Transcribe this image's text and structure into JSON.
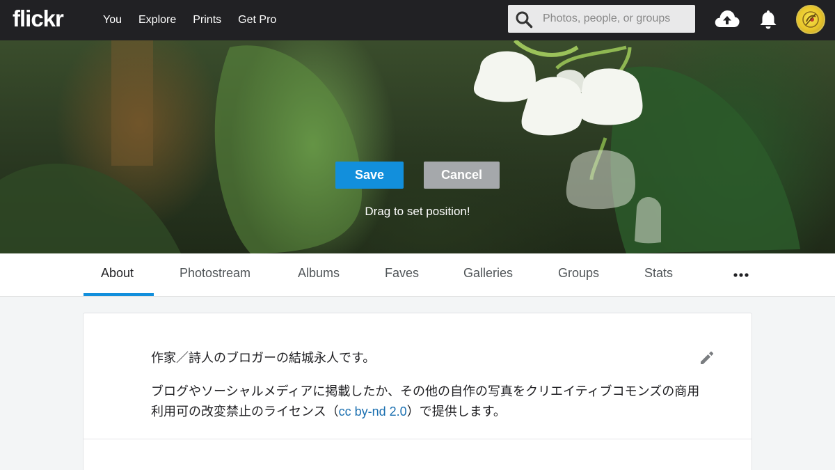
{
  "nav": {
    "logo": "flickr",
    "links": [
      "You",
      "Explore",
      "Prints",
      "Get Pro"
    ],
    "search_placeholder": "Photos, people, or groups",
    "icons": {
      "search": "search-icon",
      "upload": "cloud-upload-icon",
      "notifications": "bell-icon"
    }
  },
  "cover": {
    "save_label": "Save",
    "cancel_label": "Cancel",
    "drag_hint": "Drag to set position!"
  },
  "tabs": [
    {
      "label": "About",
      "active": true
    },
    {
      "label": "Photostream",
      "active": false
    },
    {
      "label": "Albums",
      "active": false
    },
    {
      "label": "Faves",
      "active": false
    },
    {
      "label": "Galleries",
      "active": false
    },
    {
      "label": "Groups",
      "active": false
    },
    {
      "label": "Stats",
      "active": false
    }
  ],
  "about": {
    "line1": "作家／詩人のブロガーの結城永人です。",
    "line2_before": "ブログやソーシャルメディアに掲載したか、その他の自作の写真をクリエイティブコモンズの商用利用可の改変禁止のライセンス（",
    "line2_link": "cc by-nd 2.0",
    "line2_after": "）で提供します。"
  },
  "colors": {
    "accent": "#128fdc",
    "nav_bg": "#212124",
    "link": "#1a6fb0"
  }
}
